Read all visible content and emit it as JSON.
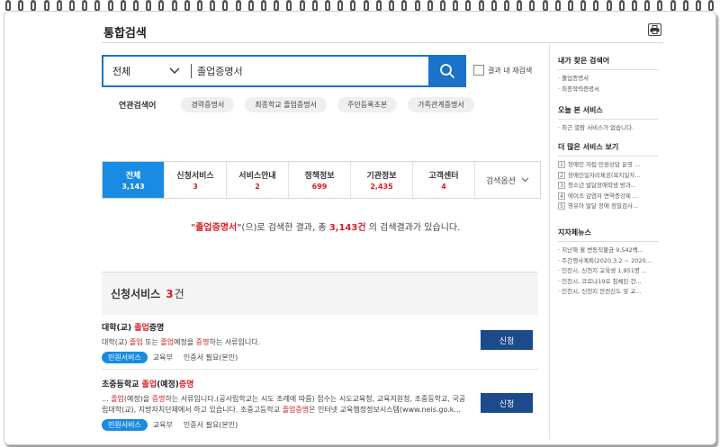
{
  "page": {
    "title": "통합검색"
  },
  "search": {
    "category": "전체",
    "query": "졸업증명서",
    "within_label": "결과 내 재검색"
  },
  "related": {
    "label": "연관검색어",
    "chips": [
      "경력증명서",
      "최종학교 졸업증명서",
      "주민등록초본",
      "가족관계증명서"
    ]
  },
  "tabs": [
    {
      "name": "전체",
      "count": "3,143"
    },
    {
      "name": "신청서비스",
      "count": "3"
    },
    {
      "name": "서비스안내",
      "count": "2"
    },
    {
      "name": "정책정보",
      "count": "699"
    },
    {
      "name": "기관정보",
      "count": "2,435"
    },
    {
      "name": "고객센터",
      "count": "4"
    }
  ],
  "tab_option": "검색옵션",
  "summary": {
    "keyword": "\"졸업증명서\"",
    "mid": "(으)로 검색한 결과, 총 ",
    "count": "3,143건",
    "tail": " 의 검색결과가 있습니다."
  },
  "section": {
    "title": "신청서비스",
    "count": "3",
    "unit": "건"
  },
  "results": [
    {
      "title_pre": "대학(교) ",
      "title_hl": "졸업",
      "title_post": "증명",
      "desc": [
        "대학(교) ",
        "졸업",
        " 또는 ",
        "졸업",
        "예정을 ",
        "증명",
        "하는 서류입니다."
      ],
      "badge": "민원서비스",
      "org": "교육부",
      "auth": "인증서 필요(본인)",
      "button": "신청"
    },
    {
      "title_pre": "초중등학교 ",
      "title_hl": "졸업",
      "title_post": "(예정)",
      "title_hl2": "증명",
      "desc": [
        "... ",
        "졸업",
        "(예정)을 ",
        "증명",
        "하는 서류입니다.(공사립학교는 시도 조례에 따름) 접수는 시도교육청, 교육지원청, 조중등학교, 국공립대학(교), 지방자치단체에서 하고 있습니다. 조중고등학교 ",
        "졸업증명",
        "은 인터넷 교육행정정보시스템(www.neis.go.k..."
      ],
      "badge": "민원서비스",
      "org": "교육부",
      "auth": "인증서 필요(본인)",
      "button": "신청"
    }
  ],
  "sidebar": {
    "my_search": {
      "title": "내가 찾은 검색어",
      "items": [
        "졸업증명서",
        "최종학력증명서"
      ]
    },
    "today": {
      "title": "오늘 본 서비스",
      "items": [
        "최근 열람 서비스가 없습니다."
      ]
    },
    "popular": {
      "title": "더 많은 서비스 보기",
      "items": [
        "장애인 자립·민원상담 운영 ...",
        "장애인일자리제공(복지일자...",
        "청소년 발달장애학생 방과...",
        "에이즈 감염자 면역증강제 ...",
        "영유아 발달 장애 정밀검사..."
      ]
    },
    "local": {
      "title": "지자체뉴스",
      "items": [
        "지난해 월 변동직불금 9,542백...",
        "주간행사계획(2020.3.2 ~ 2020....",
        "인천시, 신천지 교육생 1,951명 ...",
        "인천시, 코로나19로 침체된 건...",
        "인천시, 신천지 안전신도 및 교..."
      ]
    }
  }
}
